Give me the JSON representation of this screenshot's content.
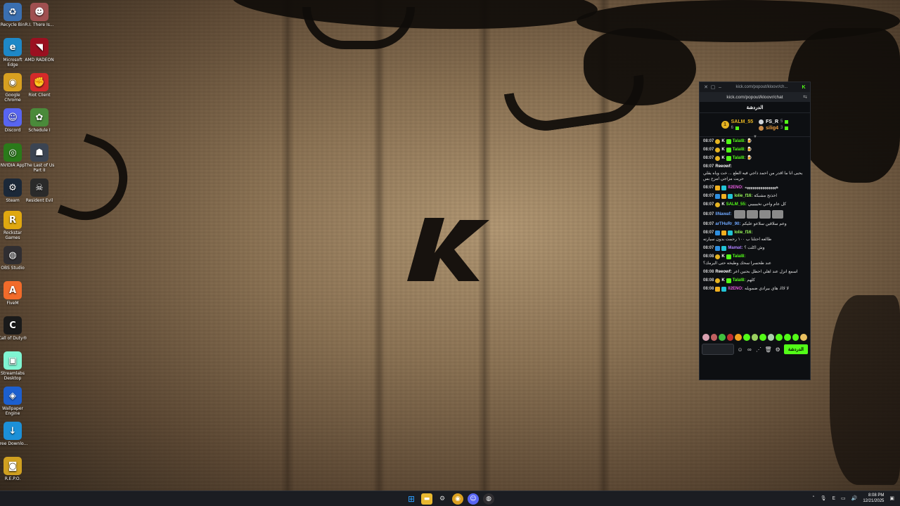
{
  "desktop": {
    "icons": [
      {
        "label": "Recycle Bin",
        "color": "#3a6fb0",
        "glyph": "♻"
      },
      {
        "label": "R.I. There Is...",
        "color": "#a05050",
        "glyph": "☻"
      },
      {
        "label": "Microsoft Edge",
        "color": "#1e88c7",
        "glyph": "e"
      },
      {
        "label": "AMD RADEON",
        "color": "#9b1020",
        "glyph": "◥"
      },
      {
        "label": "Google Chrome",
        "color": "#d8a020",
        "glyph": "◉"
      },
      {
        "label": "Riot Client",
        "color": "#d42a2a",
        "glyph": "✊"
      },
      {
        "label": "Discord",
        "color": "#5865f2",
        "glyph": "☺"
      },
      {
        "label": "Schedule I",
        "color": "#4a8a3a",
        "glyph": "✿"
      },
      {
        "label": "NVIDIA App",
        "color": "#2a7a1a",
        "glyph": "◎"
      },
      {
        "label": "The Last of Us Part II",
        "color": "#3b4452",
        "glyph": "☗"
      },
      {
        "label": "Steam",
        "color": "#1b2838",
        "glyph": "⚙"
      },
      {
        "label": "Resident Evil",
        "color": "#2a2a2a",
        "glyph": "☠"
      },
      {
        "label": "Rockstar Games",
        "color": "#e0a810",
        "glyph": "R"
      },
      {
        "label": "OBS Studio",
        "color": "#302e31",
        "glyph": "◍"
      },
      {
        "label": "FiveM",
        "color": "#f26b2a",
        "glyph": "A"
      },
      {
        "label": "Call of Duty®",
        "color": "#1a1a1a",
        "glyph": "C"
      },
      {
        "label": "Streamlabs Desktop",
        "color": "#80f5d2",
        "glyph": "▣"
      },
      {
        "label": "Wallpaper Engine",
        "color": "#1c5fcf",
        "glyph": "◈"
      },
      {
        "label": "Free Downlo...",
        "color": "#1c90d8",
        "glyph": "↓"
      },
      {
        "label": "R.E.P.O.",
        "color": "#d0a020",
        "glyph": "◙"
      }
    ]
  },
  "chat_window": {
    "title_url": "kick.com/popout/kloovr/ch...",
    "address": "kick.com/popout/kloovr/chat",
    "header": "الدردشة",
    "pinned": {
      "left": {
        "rank": "1",
        "name": "SALM_55",
        "count": "6"
      },
      "right_top": {
        "name": "FS_R",
        "count": "5"
      },
      "right_bottom": {
        "name": "silig4",
        "count": "3"
      }
    },
    "messages": [
      {
        "time": "08:07",
        "badges": [
          "b-gold",
          "b-kick",
          "b-green"
        ],
        "user": "Talal8:",
        "ucls": "u-green",
        "text": "🍺"
      },
      {
        "time": "08:07",
        "badges": [
          "b-gold",
          "b-kick",
          "b-green"
        ],
        "user": "Talal8:",
        "ucls": "u-green",
        "text": "🍺"
      },
      {
        "time": "08:07",
        "badges": [
          "b-gold",
          "b-kick",
          "b-green"
        ],
        "user": "Talal8:",
        "ucls": "u-green",
        "text": "🍺"
      },
      {
        "time": "08:07",
        "badges": [],
        "user": "Reeowf:",
        "ucls": "u-white",
        "text": "يحيى انا ما اقدر من احمد ذاجي فيه الطع ... خت وياه يقلي حريت مزاجي امزح بس"
      },
      {
        "time": "08:07",
        "badges": [
          "b-crown",
          "b-cyan"
        ],
        "user": "ll2ENO:",
        "ucls": "u-pink",
        "text": "ههههههههههههههههه"
      },
      {
        "time": "08:07",
        "badges": [
          "b-blue",
          "b-crown",
          "b-cyan"
        ],
        "user": "lolie_f16:",
        "ucls": "u-lime",
        "text": "اخذتح مشبكة"
      },
      {
        "time": "08:07",
        "badges": [
          "b-gold",
          "b-kick"
        ],
        "user": "SALM_55:",
        "ucls": "u-green",
        "text": "كل عام واحي نخيييييي"
      },
      {
        "time": "08:07",
        "badges": [],
        "user": "llNawaf:",
        "ucls": "u-blue",
        "text": ""
      },
      {
        "time": "08:07",
        "badges": [],
        "user": "arTHuRr_90:",
        "ucls": "u-blue",
        "text": "وعم سلاقين سلاعو عليكم"
      },
      {
        "time": "08:07",
        "badges": [
          "b-blue",
          "b-crown",
          "b-cyan"
        ],
        "user": "lolie_f16:",
        "ucls": "u-lime",
        "text": "طالعه احتلنا ب ١٠٠ رحمت بدون سيارته"
      },
      {
        "time": "08:07",
        "badges": [
          "b-blue",
          "b-cyan"
        ],
        "user": "Mamat:",
        "ucls": "u-purple",
        "text": "وش اكلت ؟"
      },
      {
        "time": "08:08",
        "badges": [
          "b-gold",
          "b-kick",
          "b-green"
        ],
        "user": "Talal8:",
        "ucls": "u-green",
        "text": "عند طحسرا سحك وطيخه حتى اليرمك؟"
      },
      {
        "time": "08:08",
        "badges": [],
        "user": "Reeowf:",
        "ucls": "u-white",
        "text": "اسمع انزل عند اهلي احطل بحنين اعر"
      },
      {
        "time": "08:08",
        "badges": [
          "b-gold",
          "b-kick",
          "b-green"
        ],
        "user": "Talal8:",
        "ucls": "u-green",
        "text": "كلهم"
      },
      {
        "time": "08:08",
        "badges": [
          "b-crown",
          "b-cyan"
        ],
        "user": "ll2ENO:",
        "ucls": "u-pink",
        "text": "لا لااا، هاي بيرادي ضمويله"
      }
    ],
    "input_placeholder": "",
    "send_label": "الدردشة"
  },
  "taskbar": {
    "time": "8:08 PM",
    "date": "12/21/2025",
    "lang": "E"
  }
}
